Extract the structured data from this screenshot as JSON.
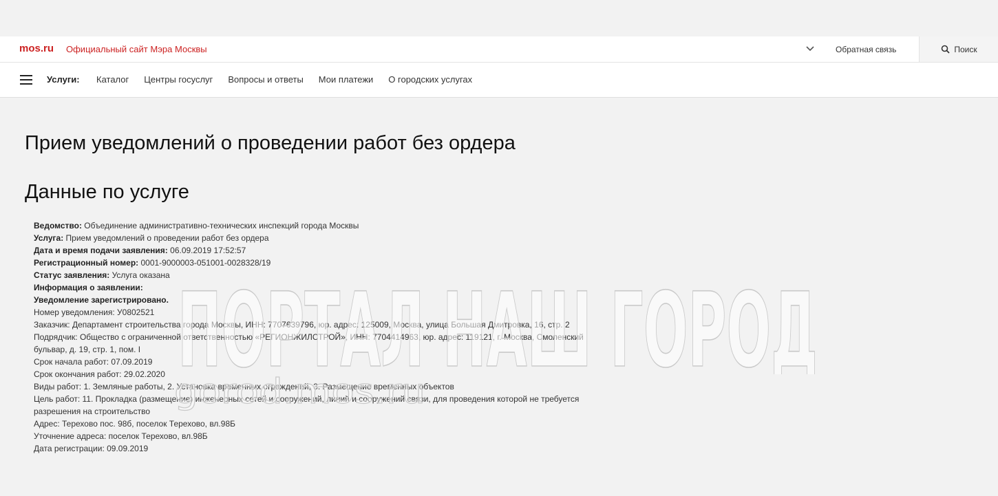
{
  "header": {
    "logo": "mos.ru",
    "site_name": "Официальный сайт Мэра Москвы",
    "feedback": "Обратная связь",
    "search": "Поиск",
    "icons": [
      "chevron-down-icon",
      "search-icon"
    ]
  },
  "nav": {
    "label": "Услуги:",
    "items": [
      "Каталог",
      "Центры госуслуг",
      "Вопросы и ответы",
      "Мои платежи",
      "О городских услугах"
    ]
  },
  "page": {
    "title": "Прием уведомлений о проведении работ без ордера",
    "section_title": "Данные по услуге"
  },
  "details": [
    {
      "label": "Ведомство:",
      "value": " Объединение административно-технических инспекций города Москвы"
    },
    {
      "label": "Услуга:",
      "value": " Прием уведомлений о проведении работ без ордера"
    },
    {
      "label": "Дата и время подачи заявления:",
      "value": " 06.09.2019 17:52:57"
    },
    {
      "label": "Регистрационный номер:",
      "value": " 0001-9000003-051001-0028328/19"
    },
    {
      "label": "Статус заявления:",
      "value": " Услуга оказана"
    },
    {
      "label": "Информация о заявлении:",
      "value": ""
    },
    {
      "label": "Уведомление зарегистрировано.",
      "value": ""
    },
    {
      "label": "",
      "value": "Номер уведомления: У0802521"
    },
    {
      "label": "",
      "value": "Заказчик: Департамент строительства города Москвы, ИНН: 7707639796, юр. адрес: 125009, Москва, улица Большая Дмитровка, 16, стр. 2"
    },
    {
      "label": "",
      "value": "Подрядчик: Общество с ограниченной ответственностью «РЕГИОНЖИЛСТРОЙ», ИНН: 7704414963, юр. адрес: 119121, г. Москва, Смоленский бульвар, д. 19, стр. 1, пом. I"
    },
    {
      "label": "",
      "value": "Срок начала работ: 07.09.2019"
    },
    {
      "label": "",
      "value": "Срок окончания работ: 29.02.2020"
    },
    {
      "label": "",
      "value": "Виды работ: 1. Земляные работы, 2. Установка временных ограждений, 3. Размещение временных объектов"
    },
    {
      "label": "",
      "value": "Цель работ: 11. Прокладка (размещение) инженерных сетей и сооружений, линий и сооружений связи, для проведения которой не требуется разрешения на строительство"
    },
    {
      "label": "",
      "value": "Адрес: Терехово пос. 98б, поселок Терехово, вл.98Б"
    },
    {
      "label": "",
      "value": "Уточнение адреса: поселок Терехово, вл.98Б"
    },
    {
      "label": "",
      "value": "Дата регистрации: 09.09.2019"
    }
  ],
  "watermark": {
    "text": "ПОРТАЛ НАШ ГОРОД",
    "url": "gorod.mos.ru"
  }
}
